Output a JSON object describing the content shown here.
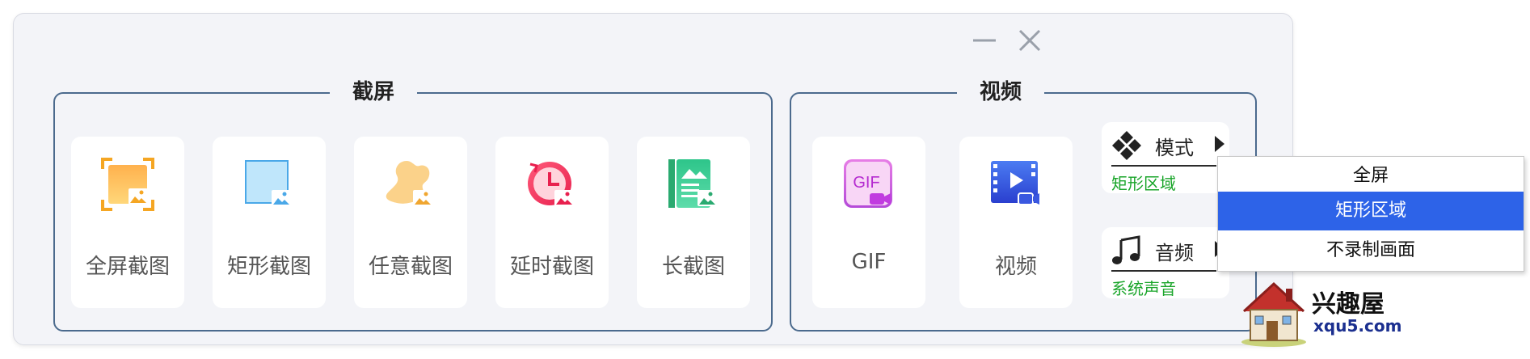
{
  "window": {
    "controls": {
      "minimize": "minimize",
      "close": "close"
    }
  },
  "screenshot_group": {
    "title": "截屏",
    "items": [
      {
        "label": "全屏截图",
        "icon": "fullscreen-capture-icon"
      },
      {
        "label": "矩形截图",
        "icon": "rectangle-capture-icon"
      },
      {
        "label": "任意截图",
        "icon": "freeform-capture-icon"
      },
      {
        "label": "延时截图",
        "icon": "delayed-capture-icon"
      },
      {
        "label": "长截图",
        "icon": "scrolling-capture-icon"
      }
    ]
  },
  "video_group": {
    "title": "视频",
    "items": [
      {
        "label": "GIF",
        "icon": "gif-record-icon",
        "icon_text": "GIF"
      },
      {
        "label": "视频",
        "icon": "video-record-icon"
      }
    ],
    "mode": {
      "label": "模式",
      "value": "矩形区域",
      "icon": "mode-diamond-icon"
    },
    "audio": {
      "label": "音频",
      "value": "系统声音",
      "icon": "music-note-icon"
    }
  },
  "mode_dropdown": {
    "options": [
      "全屏",
      "矩形区域",
      "不录制画面"
    ],
    "selected": "矩形区域"
  },
  "watermark": {
    "name": "兴趣屋",
    "url": "xqu5.com"
  },
  "colors": {
    "group_border": "#4b6a8d",
    "selected_bg": "#2d63e8",
    "value_green": "#1aa52a",
    "window_bg": "#f3f4f8"
  }
}
